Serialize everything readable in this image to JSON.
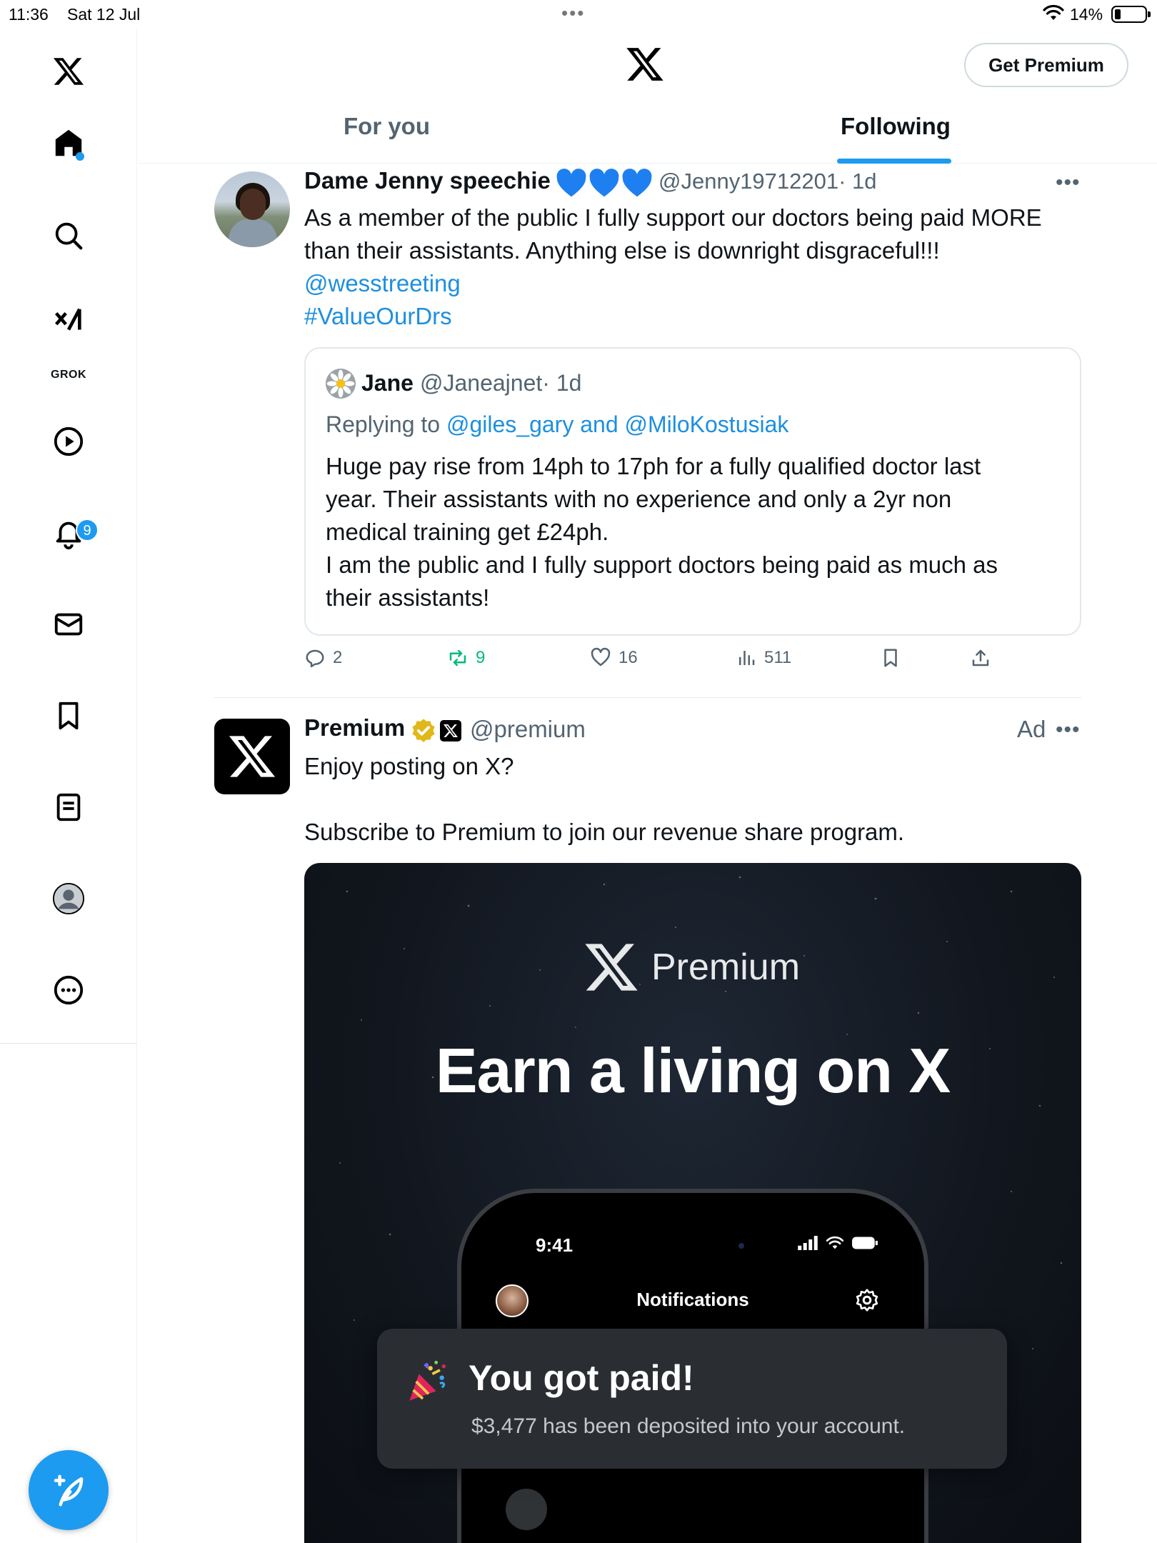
{
  "status_bar": {
    "time": "11:36",
    "date": "Sat 12 Jul",
    "battery": "14%"
  },
  "sidebar": {
    "items": [
      {
        "icon": "x-logo-icon"
      },
      {
        "icon": "home-icon"
      },
      {
        "icon": "search-icon"
      },
      {
        "icon": "grok-icon",
        "label": "GROK"
      },
      {
        "icon": "video-play-icon"
      },
      {
        "icon": "notifications-bell-icon",
        "badge": "9"
      },
      {
        "icon": "messages-mail-icon"
      },
      {
        "icon": "bookmark-icon"
      },
      {
        "icon": "lists-icon"
      },
      {
        "icon": "profile-avatar-icon"
      },
      {
        "icon": "more-icon"
      }
    ],
    "compose_icon": "compose-feather-icon"
  },
  "header": {
    "get_premium_label": "Get Premium",
    "tabs": [
      {
        "label": "For you",
        "active": false
      },
      {
        "label": "Following",
        "active": true
      }
    ]
  },
  "tweets": [
    {
      "name": "Dame Jenny speechie",
      "emoji_count": 3,
      "handle": "@Jenny19712201",
      "time": "· 1d",
      "text_line1": "As a member of the public I fully support our doctors being paid MORE",
      "text_line2": "than their assistants. Anything else is downright disgraceful!!!",
      "mention": "@wesstreeting",
      "hashtag": "#ValueOurDrs",
      "quote": {
        "name": "Jane",
        "handle": "@Janeajnet",
        "time": "· 1d",
        "reply_prefix": "Replying to",
        "reply_users": "@giles_gary and @MiloKostusiak",
        "lines": [
          "Huge pay rise from 14ph to 17ph for a fully qualified doctor last",
          "year. Their assistants with no experience and only a 2yr non",
          "medical training get £24ph.",
          "I am the public and I fully support doctors being paid as much as",
          "their assistants!"
        ]
      },
      "stats": {
        "replies": "2",
        "reposts": "9",
        "likes": "16",
        "views": "511"
      }
    },
    {
      "name": "Premium",
      "handle": "@premium",
      "ad_label": "Ad",
      "text_line1": "Enjoy posting on X?",
      "text_line2": "Subscribe to Premium to join our revenue share program.",
      "ad_card": {
        "brand_label": "Premium",
        "headline": "Earn a living on X",
        "phone_time": "9:41",
        "phone_title": "Notifications",
        "toast_title": "You got paid!",
        "toast_body": "$3,477 has been deposited into your account."
      }
    }
  ],
  "colors": {
    "accent": "#1d9bf0",
    "repost": "#00ba7c",
    "secondary_text": "#536471",
    "verified_gold": "#e2b719"
  }
}
